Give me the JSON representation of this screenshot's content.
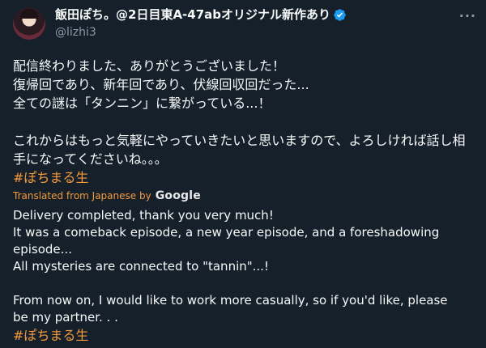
{
  "tweet": {
    "display_name": "飯田ぽち。@2日目東A-47abオリジナル新作あり",
    "handle": "@lizhi3",
    "more_label": "···",
    "body": "配信終わりました、ありがとうございました！\n復帰回であり、新年回であり、伏線回収回だった...\n全ての謎は「タンニン」に繋がっている...！\n\nこれからはもっと気軽にやっていきたいと思いますので、よろしければ話し相手になってくださいね。。。",
    "hashtag": "#ぽちまる生",
    "translated_label": "Translated from Japanese by",
    "translator": "Google",
    "translation": "Delivery completed, thank you very much!\nIt was a comeback episode, a new year episode, and a foreshadowing episode...\nAll mysteries are connected to \"tannin\"...!\n\nFrom now on, I would like to work more casually, so if you'd like, please be my partner. . .",
    "translation_hashtag": "#ぽちまる生"
  },
  "colors": {
    "background": "#15202b",
    "text": "#f7f9f9",
    "secondary": "#8b98a5",
    "accent": "#f59a3b",
    "verified": "#1d9bf0"
  },
  "icons": {
    "verified": "verified-badge-icon",
    "more": "more-horizontal-icon"
  }
}
